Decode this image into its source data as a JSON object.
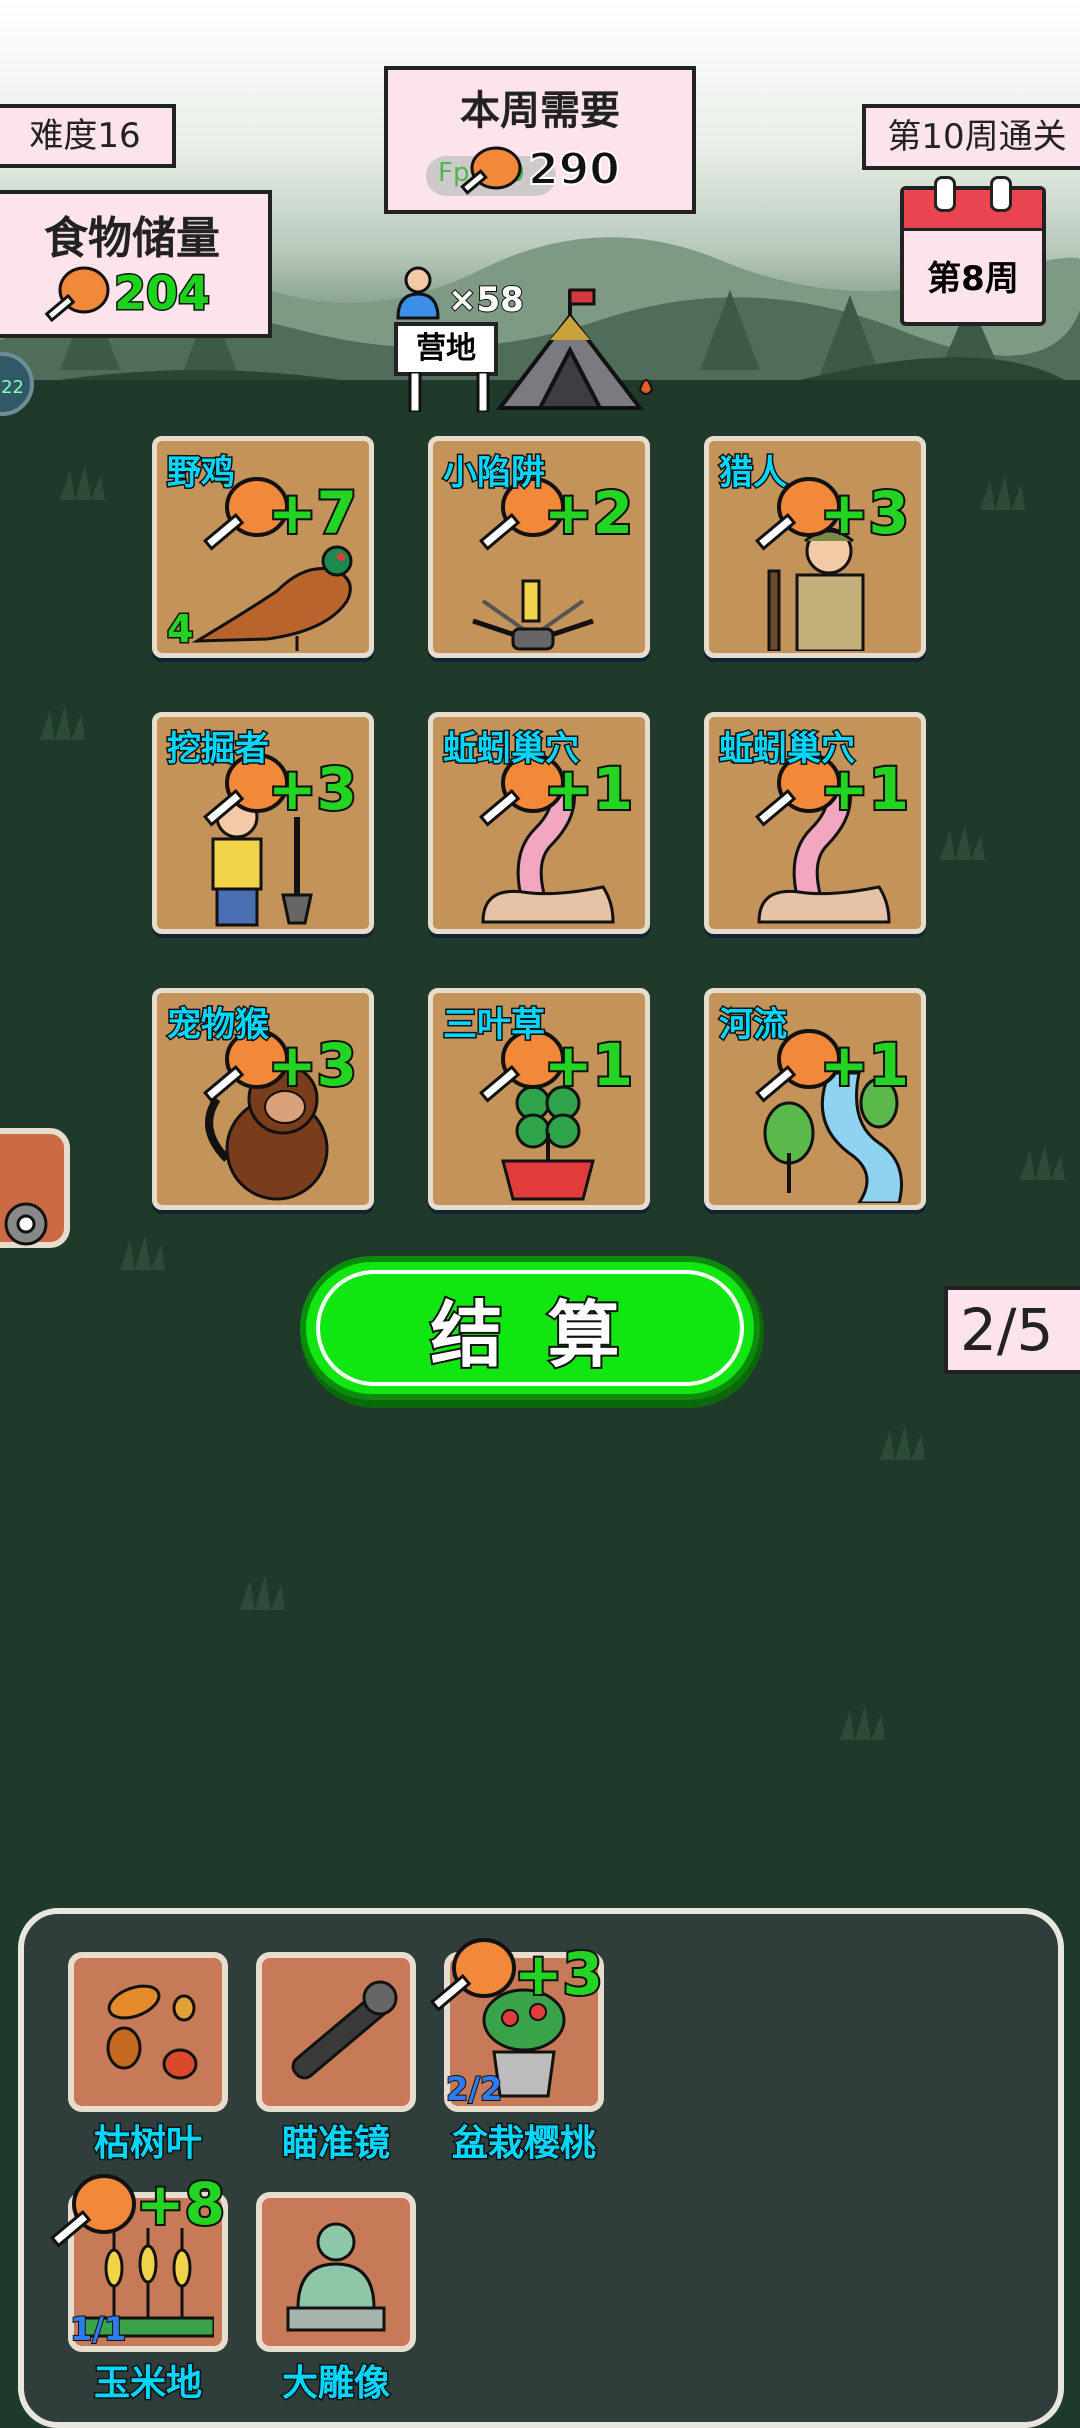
{
  "header": {
    "difficulty": "难度16",
    "weekly_need_label": "本周需要",
    "weekly_need_value": "290",
    "weekly_need_overlay": "Fps:60",
    "clear_goal": "第10周通关",
    "food_storage_label": "食物储量",
    "food_storage_value": "204",
    "current_week": "第8周",
    "population": "×58",
    "camp_label": "营地",
    "side_badge": "22"
  },
  "cards": [
    {
      "name": "野鸡",
      "plus": "+7",
      "count": "4",
      "icon": "pheasant-icon"
    },
    {
      "name": "小陷阱",
      "plus": "+2",
      "count": "",
      "icon": "trap-icon"
    },
    {
      "name": "猎人",
      "plus": "+3",
      "count": "",
      "icon": "hunter-icon"
    },
    {
      "name": "挖掘者",
      "plus": "+3",
      "count": "",
      "icon": "digger-icon"
    },
    {
      "name": "蚯蚓巢穴",
      "plus": "+1",
      "count": "",
      "icon": "worm-nest-icon"
    },
    {
      "name": "蚯蚓巢穴",
      "plus": "+1",
      "count": "",
      "icon": "worm-nest-icon"
    },
    {
      "name": "宠物猴",
      "plus": "+3",
      "count": "",
      "icon": "monkey-icon"
    },
    {
      "name": "三叶草",
      "plus": "+1",
      "count": "",
      "icon": "clover-icon"
    },
    {
      "name": "河流",
      "plus": "+1",
      "count": "",
      "icon": "river-icon"
    }
  ],
  "actions": {
    "settle_label": "结 算",
    "page_indicator": "2/5"
  },
  "inventory": [
    {
      "name": "枯树叶",
      "plus": "",
      "count": "",
      "icon": "dead-leaves-icon"
    },
    {
      "name": "瞄准镜",
      "plus": "",
      "count": "",
      "icon": "scope-icon"
    },
    {
      "name": "盆栽樱桃",
      "plus": "+3",
      "count": "2/2",
      "icon": "potted-cherry-icon"
    },
    {
      "name": "玉米地",
      "plus": "+8",
      "count": "1/1",
      "icon": "cornfield-icon"
    },
    {
      "name": "大雕像",
      "plus": "",
      "count": "",
      "icon": "statue-icon"
    }
  ],
  "colors": {
    "card_bg": "#c3935a",
    "item_bg": "#c77a57",
    "settle_green": "#11e611",
    "name_cyan": "#00d7ff",
    "plus_green": "#23d423"
  }
}
